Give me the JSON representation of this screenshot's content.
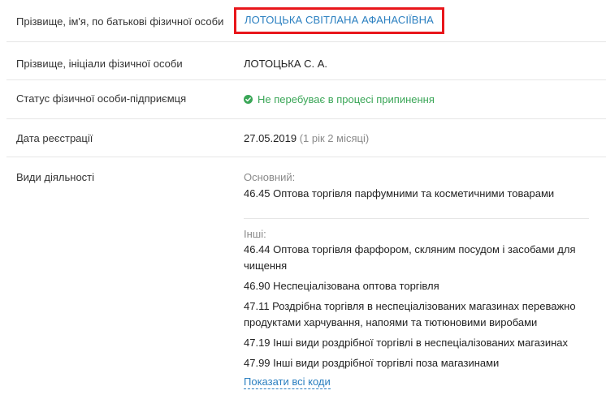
{
  "fields": {
    "full_name": {
      "label": "Прізвище, ім'я, по батькові фізичної особи",
      "value": "ЛОТОЦЬКА СВІТЛАНА АФАНАСІЇВНА"
    },
    "short_name": {
      "label": "Прізвище, ініціали фізичної особи",
      "value": "ЛОТОЦЬКА С. А."
    },
    "status": {
      "label": "Статус фізичної особи-підприємця",
      "value": "Не перебуває в процесі припинення"
    },
    "registration_date": {
      "label": "Дата реєстрації",
      "date": "27.05.2019",
      "duration": "(1 рік 2 місяці)"
    },
    "activities": {
      "label": "Види діяльності",
      "main_caption": "Основний:",
      "main": "46.45 Оптова торгівля парфумними та косметичними товарами",
      "other_caption": "Інші:",
      "others": [
        "46.44 Оптова торгівля фарфором, скляним посудом і засобами для чищення",
        "46.90 Неспеціалізована оптова торгівля",
        "47.11 Роздрібна торгівля в неспеціалізованих магазинах переважно продуктами харчування, напоями та тютюновими виробами",
        "47.19 Інші види роздрібної торгівлі в неспеціалізованих магазинах",
        "47.99 Інші види роздрібної торгівлі поза магазинами"
      ],
      "show_all": "Показати всі коди"
    }
  },
  "colors": {
    "link": "#2a7fc0",
    "highlight_border": "#e8161b",
    "status_ok": "#3aa657",
    "muted": "#8a8a8a"
  },
  "icons": {
    "status": "check-circle-icon"
  }
}
